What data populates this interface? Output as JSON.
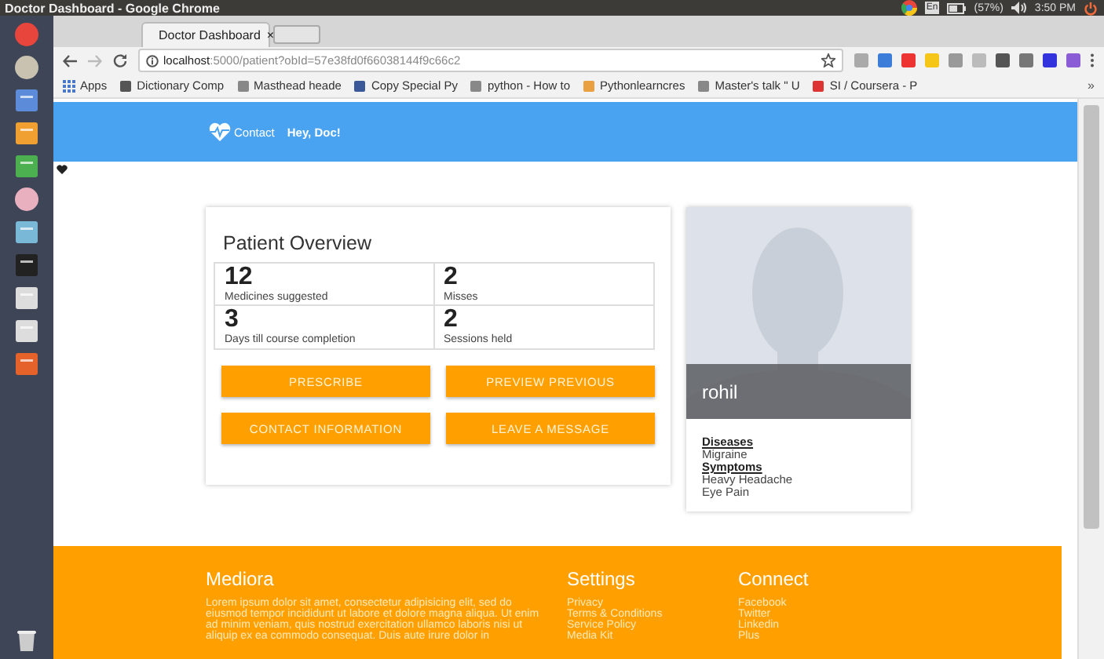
{
  "system_bar": {
    "title": "Doctor Dashboard - Google Chrome",
    "keyboard": "En",
    "battery": "(57%)",
    "time": "3:50 PM"
  },
  "browser": {
    "tab": {
      "title": "Doctor Dashboard",
      "close": "×"
    },
    "url": {
      "host": "localhost",
      "path": ":5000/patient?obId=57e38fd0f66038144f9c66c2"
    },
    "bookmarks": [
      {
        "label": "Apps"
      },
      {
        "label": "Dictionary Comp"
      },
      {
        "label": "Masthead heade"
      },
      {
        "label": "Copy Special Py"
      },
      {
        "label": "python - How to"
      },
      {
        "label": "Pythonlearncres"
      },
      {
        "label": "Master's talk \" U"
      },
      {
        "label": "SI / Coursera - P"
      }
    ],
    "more": "»"
  },
  "navbar": {
    "brand": "Contact",
    "greeting": "Hey, Doc!"
  },
  "overview": {
    "title": "Patient Overview",
    "stats": [
      {
        "value": "12",
        "label": "Medicines suggested"
      },
      {
        "value": "2",
        "label": "Misses"
      },
      {
        "value": "3",
        "label": "Days till course completion"
      },
      {
        "value": "2",
        "label": "Sessions held"
      }
    ],
    "buttons": [
      "PRESCRIBE",
      "PREVIEW PREVIOUS",
      "CONTACT INFORMATION",
      "LEAVE A MESSAGE"
    ]
  },
  "patient": {
    "name": "rohil",
    "sections": [
      {
        "heading": "Diseases",
        "items": [
          "Migraine"
        ]
      },
      {
        "heading": "Symptoms",
        "items": [
          "Heavy Headache",
          "Eye Pain"
        ]
      }
    ]
  },
  "footer": {
    "about": {
      "title": "Mediora",
      "text": "Lorem ipsum dolor sit amet, consectetur adipisicing elit, sed do eiusmod tempor incididunt ut labore et dolore magna aliqua. Ut enim ad minim veniam, quis nostrud exercitation ullamco laboris nisi ut aliquip ex ea commodo consequat. Duis aute irure dolor in"
    },
    "columns": [
      {
        "title": "Settings",
        "links": [
          "Privacy",
          "Terms & Conditions",
          "Service Policy",
          "Media Kit"
        ]
      },
      {
        "title": "Connect",
        "links": [
          "Facebook",
          "Twitter",
          "Linkedin",
          "Plus"
        ]
      }
    ]
  }
}
